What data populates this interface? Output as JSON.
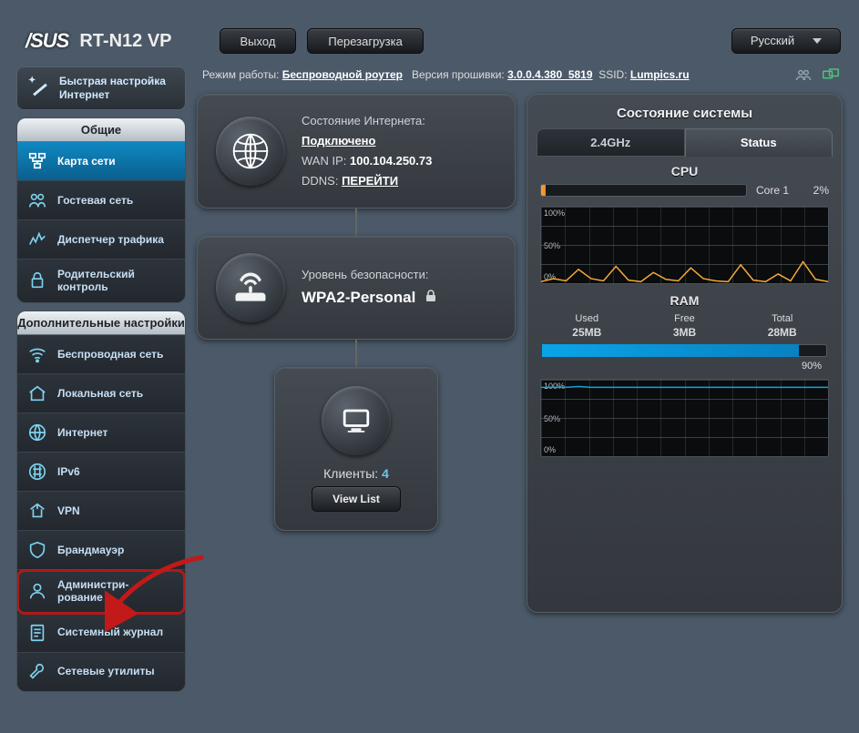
{
  "header": {
    "brand": "/SUS",
    "model": "RT-N12 VP",
    "logout": "Выход",
    "reboot": "Перезагрузка",
    "language": "Русский"
  },
  "wizard": {
    "label": "Быстрая настройка Интернет"
  },
  "section_general": {
    "title": "Общие",
    "items": [
      {
        "id": "network-map",
        "label": "Карта сети",
        "active": true
      },
      {
        "id": "guest-network",
        "label": "Гостевая сеть"
      },
      {
        "id": "traffic-manager",
        "label": "Диспетчер трафика"
      },
      {
        "id": "parental-control",
        "label": "Родительский контроль"
      }
    ]
  },
  "section_advanced": {
    "title": "Дополнительные настройки",
    "items": [
      {
        "id": "wireless",
        "label": "Беспроводная сеть"
      },
      {
        "id": "lan",
        "label": "Локальная сеть"
      },
      {
        "id": "wan",
        "label": "Интернет"
      },
      {
        "id": "ipv6",
        "label": "IPv6"
      },
      {
        "id": "vpn",
        "label": "VPN"
      },
      {
        "id": "firewall",
        "label": "Брандмауэр"
      },
      {
        "id": "administration",
        "label": "Администри-рование",
        "highlight": true
      },
      {
        "id": "system-log",
        "label": "Системный журнал"
      },
      {
        "id": "network-tools",
        "label": "Сетевые утилиты"
      }
    ]
  },
  "statusbar": {
    "mode_label": "Режим работы:",
    "mode_value": "Беспроводной роутер",
    "fw_label": "Версия прошивки:",
    "fw_value": "3.0.0.4.380_5819",
    "ssid_label": "SSID:",
    "ssid_value": "Lumpics.ru"
  },
  "internet": {
    "title": "Состояние Интернета:",
    "status": "Подключено",
    "wanip_label": "WAN IP:",
    "wanip": "100.104.250.73",
    "ddns_label": "DDNS:",
    "ddns_link": "ПЕРЕЙТИ"
  },
  "security": {
    "title": "Уровень безопасности:",
    "value": "WPA2-Personal"
  },
  "clients": {
    "title": "Клиенты:",
    "count": "4",
    "view": "View List"
  },
  "system": {
    "panel_title": "Состояние системы",
    "tab1": "2.4GHz",
    "tab2": "Status",
    "cpu": {
      "title": "CPU",
      "core_label": "Core 1",
      "core_pct": "2%",
      "core_pct_num": 2,
      "ytick_top": "100%",
      "ytick_mid": "50%",
      "ytick_bot": "0%"
    },
    "ram": {
      "title": "RAM",
      "used_label": "Used",
      "used": "25MB",
      "free_label": "Free",
      "free": "3MB",
      "total_label": "Total",
      "total": "28MB",
      "pct": "90%",
      "pct_num": 90,
      "ytick_top": "100%",
      "ytick_mid": "50%",
      "ytick_bot": "0%"
    }
  },
  "chart_data": [
    {
      "type": "line",
      "title": "CPU",
      "ylim": [
        0,
        100
      ],
      "series": [
        {
          "name": "Core 1",
          "values": [
            2,
            6,
            3,
            18,
            6,
            3,
            22,
            4,
            2,
            14,
            5,
            3,
            20,
            6,
            3,
            2,
            24,
            4,
            2,
            12,
            3,
            28,
            5,
            2
          ]
        }
      ]
    },
    {
      "type": "line",
      "title": "RAM",
      "ylim": [
        0,
        100
      ],
      "series": [
        {
          "name": "RAM",
          "values": [
            90,
            90,
            90,
            91,
            90,
            90,
            90,
            90,
            90,
            90,
            90,
            90,
            90,
            90,
            90,
            90,
            90,
            90,
            90,
            90,
            90,
            90,
            90,
            90
          ]
        }
      ]
    }
  ]
}
